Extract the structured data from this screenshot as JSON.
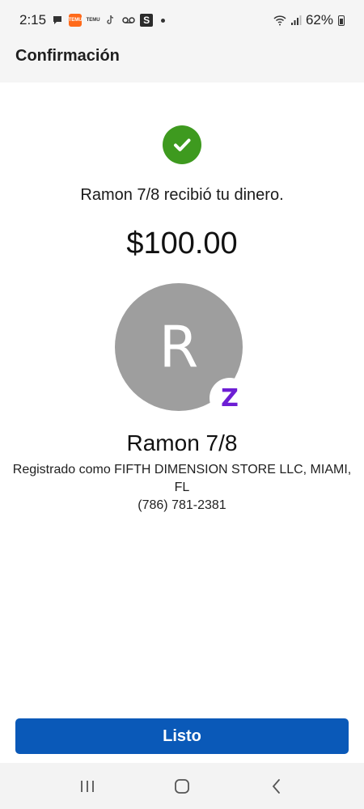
{
  "status_bar": {
    "time": "2:15",
    "notification_icons": [
      "chat-bubble-icon",
      "temu-icon",
      "temu-icon",
      "tiktok-icon",
      "voicemail-icon",
      "s-app-icon",
      "dot-icon"
    ],
    "temu_label": "TEMU",
    "s_label": "S",
    "battery": "62%",
    "system_icons": [
      "wifi-icon",
      "signal-icon",
      "battery-icon"
    ]
  },
  "header": {
    "title": "Confirmación"
  },
  "confirmation": {
    "status_icon": "checkmark-icon",
    "message": "Ramon 7/8 recibió tu dinero.",
    "amount": "$100.00"
  },
  "recipient": {
    "avatar_initial": "R",
    "badge_icon": "zelle-icon",
    "badge_letter": "Z",
    "name": "Ramon 7/8",
    "registered_as": "Registrado como FIFTH DIMENSION STORE LLC, MIAMI, FL",
    "phone": "(786) 781-2381"
  },
  "actions": {
    "done_label": "Listo"
  },
  "nav": {
    "icons": [
      "recent-apps-icon",
      "home-icon",
      "back-icon"
    ]
  },
  "colors": {
    "accent": "#0a59b8",
    "success": "#3e9a1f",
    "zelle": "#6d1ed4",
    "avatar": "#9e9e9e"
  }
}
